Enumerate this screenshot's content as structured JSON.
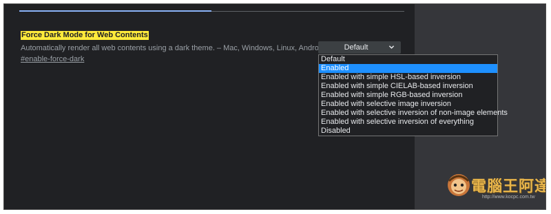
{
  "flag": {
    "title": "Force Dark Mode for Web Contents",
    "description": "Automatically render all web contents using a dark theme. – Mac, Windows, Linux, Android",
    "link": "#enable-force-dark"
  },
  "select": {
    "value": "Default",
    "options": [
      "Default",
      "Enabled",
      "Enabled with simple HSL-based inversion",
      "Enabled with simple CIELAB-based inversion",
      "Enabled with simple RGB-based inversion",
      "Enabled with selective image inversion",
      "Enabled with selective inversion of non-image elements",
      "Enabled with selective inversion of everything",
      "Disabled"
    ],
    "highlighted": "Enabled"
  },
  "watermark": {
    "text": "電腦王阿達",
    "url": "http://www.kocpc.com.tw"
  },
  "colors": {
    "background": "#202124",
    "highlight_yellow": "#ffeb3b",
    "selected_option": "#1e90ff",
    "tab_active": "#8ab4f8"
  }
}
